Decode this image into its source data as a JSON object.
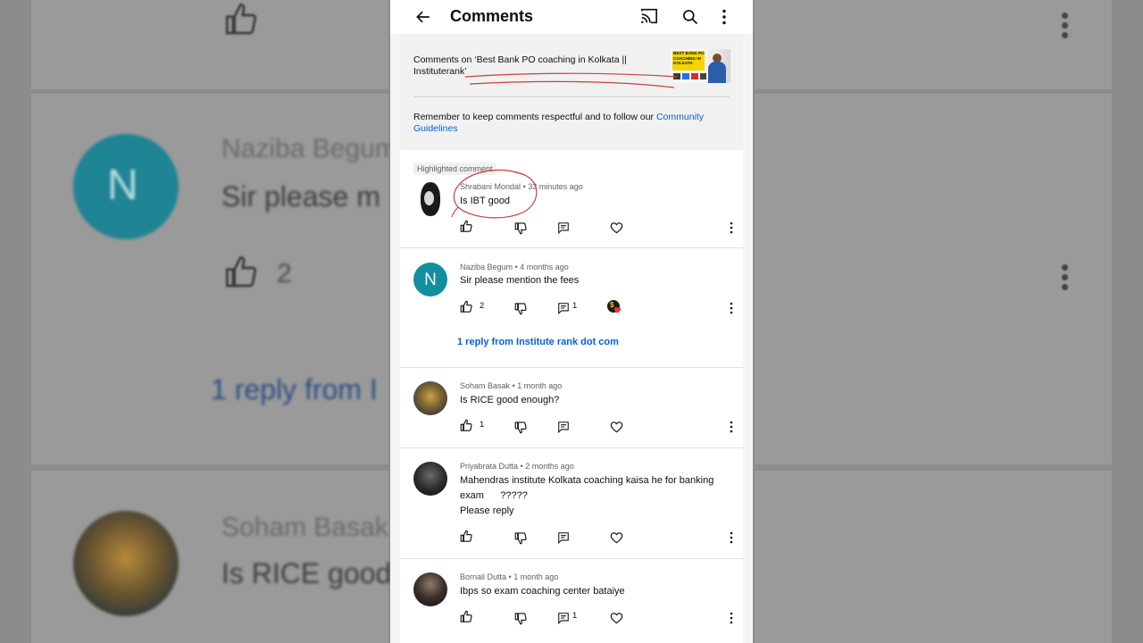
{
  "header": {
    "title": "Comments",
    "icons": [
      "back-arrow-icon",
      "cast-icon",
      "search-icon",
      "more-vertical-icon"
    ]
  },
  "video_info": {
    "comments_on": "Comments on ‘Best Bank PO coaching in Kolkata || Instituterank’",
    "thumbnail_lines": [
      "BEST BANK PO",
      "COACHING IN",
      "KOLKATA"
    ],
    "reminder": "Remember to keep comments respectful and to follow our",
    "guidelines_link": "Community Guidelines"
  },
  "colors": {
    "link": "#065fd4",
    "annotation": "#c8403c",
    "avatar_teal": "#118ea0",
    "heart": "#e53935"
  },
  "comments": [
    {
      "highlight_label": "Highlighted comment",
      "author": "Shrabani Mondal",
      "time": "33 minutes ago",
      "lines": [
        "Is IBT good"
      ],
      "likes": "",
      "replies": ""
    },
    {
      "author": "Naziba Begum",
      "avatar_letter": "N",
      "time": "4 months ago",
      "lines": [
        "Sir please mention the fees"
      ],
      "likes": "2",
      "replies": "1",
      "creator_badge": "$",
      "reply_link": "1 reply from Institute rank dot com"
    },
    {
      "author": "Soham Basak",
      "time": "1 month ago",
      "lines": [
        "Is RICE good enough?"
      ],
      "likes": "1",
      "replies": ""
    },
    {
      "author": "Priyabrata Dutta",
      "time": "2 months ago",
      "lines": [
        "Mahendras institute Kolkata coaching kaisa he for banking",
        "exam      ?????",
        "Please reply"
      ],
      "likes": "",
      "replies": ""
    },
    {
      "author": "Bornali Dutta",
      "time": "1 month ago",
      "lines": [
        "Ibps so exam coaching center bataiye"
      ],
      "likes": "",
      "replies": "1"
    }
  ],
  "background": {
    "name1": "Naziba Begum",
    "text1": "Sir please m",
    "likes": "2",
    "reply": "1 reply from I",
    "name2": "Soham Basak",
    "text2": "Is RICE good"
  }
}
